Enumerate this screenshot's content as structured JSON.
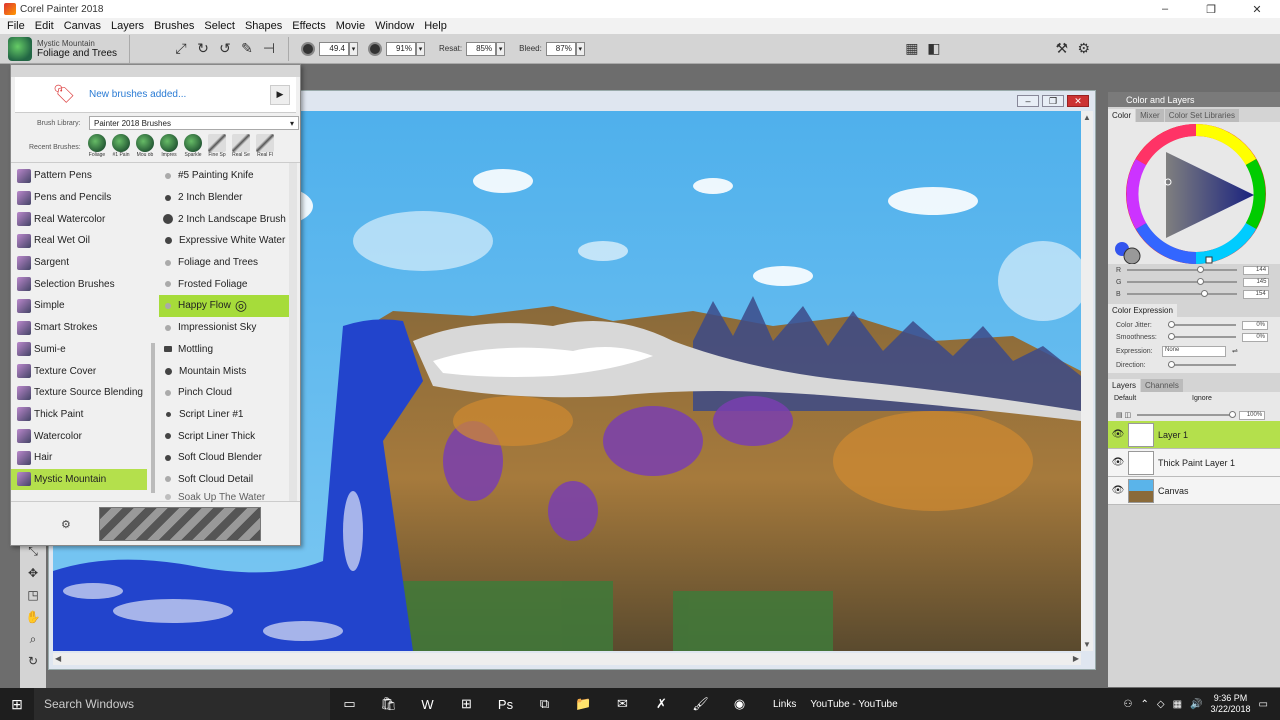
{
  "window": {
    "title": "Corel Painter 2018",
    "minimize": "–",
    "restore": "❐",
    "close": "✕"
  },
  "menu": [
    "File",
    "Edit",
    "Canvas",
    "Layers",
    "Brushes",
    "Select",
    "Shapes",
    "Effects",
    "Movie",
    "Window",
    "Help"
  ],
  "propbar": {
    "brush_category": "Mystic Mountain",
    "brush_variant": "Foliage and Trees",
    "size_value": "49.4",
    "opacity_value": "91%",
    "resat_label": "Resat:",
    "resat_value": "85%",
    "bleed_label": "Bleed:",
    "bleed_value": "87%"
  },
  "brush_panel": {
    "new_brushes_text": "New brushes added...",
    "library_label": "Brush Library:",
    "library_value": "Painter 2018 Brushes",
    "recent_label": "Recent Brushes:",
    "recent_brushes": [
      "Foliage",
      "#1 Pain",
      "Mou ob",
      "Impres",
      "Sparkle",
      "Fine Sp",
      "Real Se",
      "Real Fl"
    ],
    "categories": [
      "Pattern Pens",
      "Pens and Pencils",
      "Real Watercolor",
      "Real Wet Oil",
      "Sargent",
      "Selection Brushes",
      "Simple",
      "Smart Strokes",
      "Sumi-e",
      "Texture Cover",
      "Texture Source Blending",
      "Thick Paint",
      "Watercolor",
      "Hair",
      "Mystic Mountain"
    ],
    "selected_category": "Mystic Mountain",
    "variants": [
      "#5 Painting Knife",
      "2 Inch Blender",
      "2 Inch Landscape Brush",
      "Expressive White Water",
      "Foliage and Trees",
      "Frosted Foliage",
      "Happy Flow",
      "Impressionist Sky",
      "Mottling",
      "Mountain Mists",
      "Pinch Cloud",
      "Script Liner #1",
      "Script Liner Thick",
      "Soft Cloud Blender",
      "Soft Cloud Detail",
      "Soak Up The Water"
    ],
    "selected_variant": "Happy Flow"
  },
  "right_panel": {
    "color_header": "Color and Layers",
    "color_tabs": [
      "Color",
      "Mixer",
      "Color Set Libraries"
    ],
    "rgb": [
      {
        "label": "R",
        "value": "144"
      },
      {
        "label": "G",
        "value": "145"
      },
      {
        "label": "B",
        "value": "154"
      }
    ],
    "color_expression_tab": "Color Expression",
    "expression_rows": [
      {
        "label": "Color Jitter:",
        "value": "0%"
      },
      {
        "label": "Smoothness:",
        "value": "0%"
      }
    ],
    "expression_label": "Expression:",
    "expression_value": "None",
    "direction_label": "Direction:",
    "layers_tabs": [
      "Layers",
      "Channels"
    ],
    "blend_mode": "Default",
    "composite": "Ignore",
    "opacity": "100%",
    "layers": [
      "Layer 1",
      "Thick Paint Layer 1",
      "Canvas"
    ],
    "selected_layer": "Layer 1"
  },
  "taskbar": {
    "search_placeholder": "Search Windows",
    "youtube_label": "YouTube - YouTube",
    "links_label": "Links",
    "time": "9:36 PM",
    "date": "3/22/2018"
  },
  "colors": {
    "selection_green": "#b4e04c",
    "sky_blue": "#5ab4ea",
    "water_blue": "#2244cc",
    "link_blue": "#2a7bd4"
  }
}
